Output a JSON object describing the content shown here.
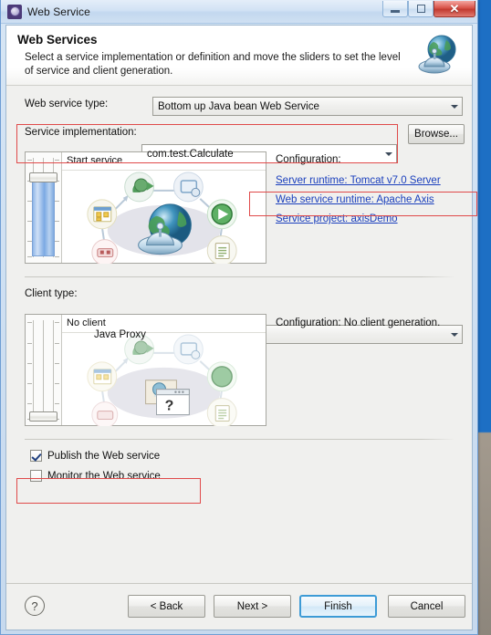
{
  "window": {
    "title": "Web Service",
    "icon": "web-service-icon",
    "controls": {
      "minimize": "minimize-icon",
      "maximize": "maximize-icon",
      "close": "✕"
    }
  },
  "header": {
    "title": "Web Services",
    "description": "Select a service implementation or definition and move the sliders to set the level of service and client generation.",
    "icon": "globe-service-icon"
  },
  "service": {
    "type_label": "Web service type:",
    "type_value": "Bottom up Java bean Web Service",
    "impl_label": "Service implementation:",
    "impl_value": "com.test.Calculate",
    "browse_label": "Browse...",
    "slider_caption": "Start service",
    "slider_level": 85,
    "configuration": {
      "label": "Configuration:",
      "links": [
        "Server runtime: Tomcat v7.0 Server",
        "Web service runtime: Apache Axis",
        "Service project: axisDemo"
      ]
    }
  },
  "client": {
    "type_label": "Client type:",
    "type_value": "Java Proxy",
    "slider_caption": "No client",
    "slider_level": 0,
    "configuration_note": "Configuration: No client generation."
  },
  "options": [
    {
      "label": "Publish the Web service",
      "checked": true
    },
    {
      "label": "Monitor the Web service",
      "checked": false
    }
  ],
  "footer": {
    "help_icon": "?",
    "buttons": [
      {
        "label": "< Back",
        "default": false
      },
      {
        "label": "Next >",
        "default": false
      },
      {
        "label": "Finish",
        "default": true
      },
      {
        "label": "Cancel",
        "default": false
      }
    ]
  },
  "annotations": {
    "accent_color": "#e04a4a",
    "boxes": [
      "service-implementation-row",
      "server-runtime-link",
      "publish-checkbox"
    ]
  }
}
